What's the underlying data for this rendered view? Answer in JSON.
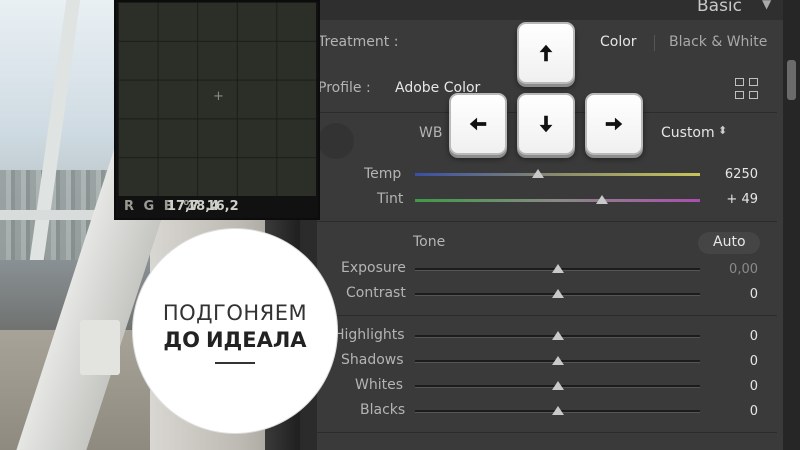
{
  "panel_title": "Basic",
  "treatment": {
    "label": "Treatment :",
    "options": [
      "Color",
      "Black & White"
    ],
    "selected": "Color"
  },
  "profile": {
    "label": "Profile :",
    "value": "Adobe Color"
  },
  "wb": {
    "label": "WB",
    "value": "Custom"
  },
  "temp": {
    "label": "Temp",
    "value": "6250",
    "position": 0.44
  },
  "tint": {
    "label": "Tint",
    "value": "+ 49",
    "position": 0.66
  },
  "tone": {
    "label": "Tone",
    "auto_label": "Auto"
  },
  "sliders": [
    {
      "label": "Exposure",
      "value": "0,00",
      "position": 0.5,
      "dim": true
    },
    {
      "label": "Contrast",
      "value": "0",
      "position": 0.5,
      "dim": false
    },
    {
      "label": "Highlights",
      "value": "0",
      "position": 0.5,
      "dim": false
    },
    {
      "label": "Shadows",
      "value": "0",
      "position": 0.5,
      "dim": false
    },
    {
      "label": "Whites",
      "value": "0",
      "position": 0.5,
      "dim": false
    },
    {
      "label": "Blacks",
      "value": "0",
      "position": 0.5,
      "dim": false
    }
  ],
  "loupe": {
    "r_label": "R",
    "r": "17,7",
    "g_label": "G",
    "g": "18,4",
    "b_label": "B",
    "b": "16,2",
    "unit": "%"
  },
  "overlay": {
    "line1": "ПОДГОНЯЕМ",
    "line2a": "ДО",
    "line2b": "ИДЕАЛА"
  },
  "keys": [
    "arrow-up",
    "arrow-left",
    "arrow-down",
    "arrow-right"
  ],
  "colors": {
    "panel_bg": "#3a3a3a",
    "text": "#b4b4b4",
    "text_bright": "#e6e6e6"
  }
}
